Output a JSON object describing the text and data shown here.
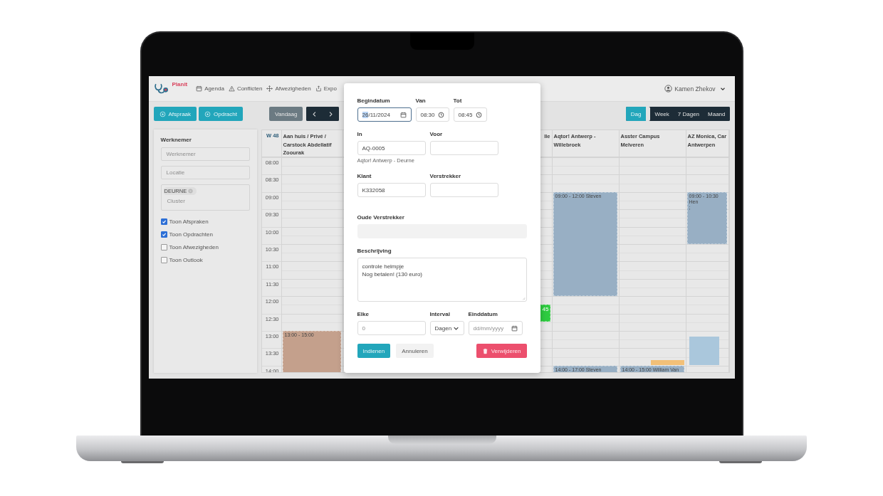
{
  "navbar": {
    "logo": "Planit",
    "items": [
      {
        "label": "Agenda"
      },
      {
        "label": "Conflicten"
      },
      {
        "label": "Afwezigheden"
      },
      {
        "label": "Expo"
      }
    ],
    "user": "Kamen Zhekov"
  },
  "toolbar": {
    "create_buttons": [
      "Afspraak",
      "Opdracht"
    ],
    "today": "Vandaag",
    "views": [
      {
        "label": "Dag",
        "selected": true
      },
      {
        "label": "Week",
        "selected": false
      },
      {
        "label": "7 Dagen",
        "selected": false
      },
      {
        "label": "Maand",
        "selected": false
      }
    ]
  },
  "sidebar": {
    "title": "Werknemer",
    "fields": [
      {
        "placeholder": "Werknemer"
      },
      {
        "placeholder": "Locatie"
      }
    ],
    "cluster": {
      "tags": [
        "DEURNE"
      ],
      "placeholder": "Cluster"
    },
    "toggles": [
      {
        "label": "Toon Afspraken",
        "checked": true
      },
      {
        "label": "Toon Opdrachten",
        "checked": true
      },
      {
        "label": "Toon Afwezigheden",
        "checked": false
      },
      {
        "label": "Toon Outlook",
        "checked": false
      }
    ]
  },
  "calendar": {
    "week": "W 48",
    "times": [
      "08:00",
      "08:30",
      "09:00",
      "09:30",
      "10:00",
      "10:30",
      "11:00",
      "11:30",
      "12:00",
      "12:30",
      "13:00",
      "13:30",
      "14:00"
    ],
    "columns": [
      {
        "kind": "full",
        "title": "Aan huis / Privé / Carstock Abdellatif Zoourak",
        "events": [
          {
            "kind": "event",
            "label": "13:00 - 15:00",
            "color": "#c4a08c"
          }
        ]
      },
      {
        "kind": "partial",
        "title": "lle",
        "events": [
          {
            "kind": "stub",
            "label": "45",
            "color": "#2ecc40"
          }
        ]
      },
      {
        "kind": "full",
        "title": "Aqtor! Antwerp - Willebroek",
        "events": [
          {
            "kind": "event",
            "label": "09:00 - 12:00 Steven",
            "color": "#98afc4"
          },
          {
            "kind": "event",
            "label": "14:00 - 17:00 Steven",
            "color": "#98afc4"
          }
        ]
      },
      {
        "kind": "full",
        "title": "Asster Campus Melveren",
        "events": [
          {
            "kind": "event",
            "label": "14:00 - 15:00 William Van",
            "color": "#98afc4"
          },
          {
            "kind": "marker",
            "color": "#f2c078"
          }
        ]
      },
      {
        "kind": "full",
        "title": "AZ Monica, Car Antwerpen",
        "events": [
          {
            "kind": "event",
            "label": "09:00 - 10:30 Hen\n;",
            "color": "#98afc4"
          },
          {
            "kind": "block",
            "color": "#aac7dc"
          }
        ]
      }
    ]
  },
  "dialog": {
    "rows": [
      {
        "fields": [
          {
            "label": "Begindatum",
            "kind": "date",
            "value": "26/11/2024",
            "focused": true
          },
          {
            "label": "Van",
            "kind": "time",
            "value": "08:30",
            "focused": false
          },
          {
            "label": "Tot",
            "kind": "time",
            "value": "08:45",
            "focused": false
          }
        ]
      },
      {
        "fields": [
          {
            "label": "In",
            "kind": "text",
            "value": "AQ-0005",
            "help": "Aqtor! Antwerp - Deurne",
            "focused": false
          },
          {
            "label": "Voor",
            "kind": "text",
            "focused": false
          }
        ]
      },
      {
        "fields": [
          {
            "label": "Klant",
            "kind": "text",
            "value": "K332058",
            "focused": false
          },
          {
            "label": "Verstrekker",
            "kind": "text",
            "focused": false
          }
        ]
      },
      {
        "fields": [
          {
            "label": "Oude Verstrekker",
            "kind": "readonly",
            "focused": false
          }
        ]
      },
      {
        "fields": [
          {
            "label": "Beschrijving",
            "kind": "textarea",
            "value": "controle helmpje\nNog betalen! (130 euro)",
            "focused": false
          }
        ]
      },
      {
        "fields": [
          {
            "label": "Elke",
            "kind": "text",
            "placeholder": "0",
            "focused": false
          },
          {
            "label": "Interval",
            "kind": "select",
            "value": "Dagen",
            "focused": false
          },
          {
            "label": "Einddatum",
            "kind": "date",
            "placeholder": "dd/mm/yyyy",
            "focused": false
          }
        ]
      }
    ],
    "buttons": [
      {
        "label": "Indienen",
        "kind": "primary"
      },
      {
        "label": "Annuleren",
        "kind": "secondary"
      },
      {
        "label": "Verwijderen",
        "kind": "danger"
      }
    ]
  }
}
